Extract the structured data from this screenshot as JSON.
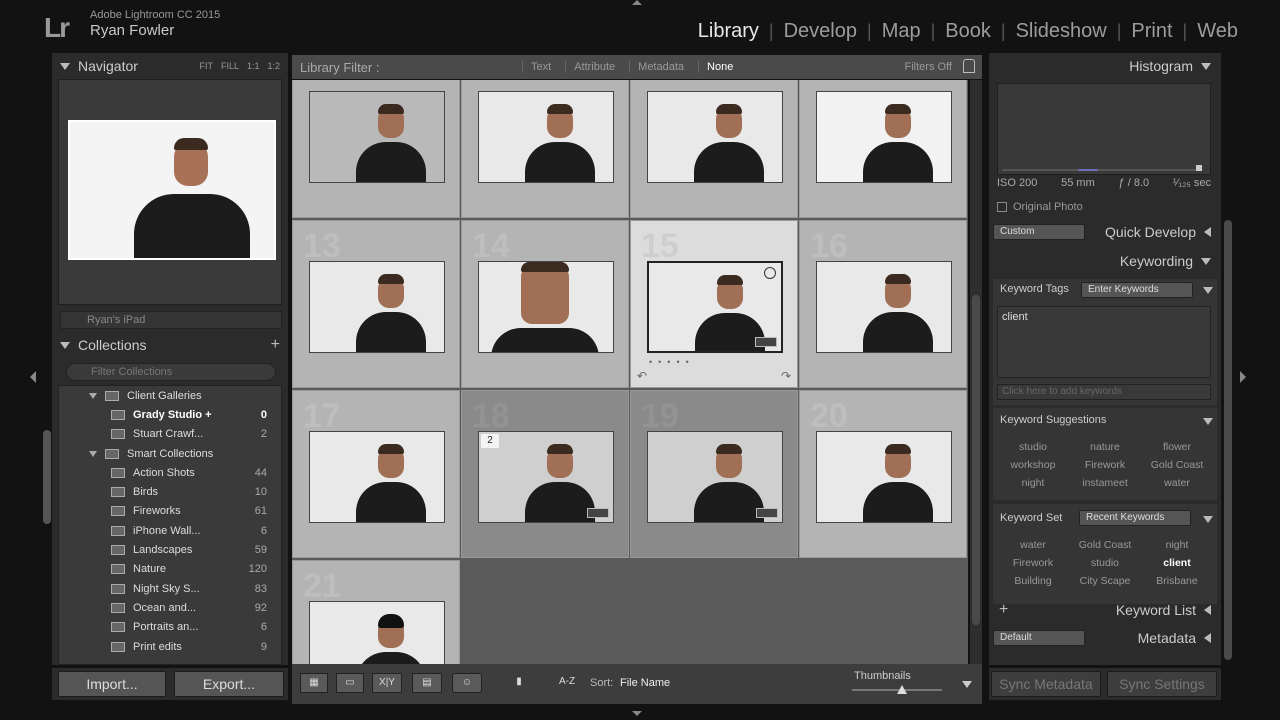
{
  "identity": {
    "logo": "Lr",
    "app_name": "Adobe Lightroom CC 2015",
    "user": "Ryan Fowler"
  },
  "modules": [
    "Library",
    "Develop",
    "Map",
    "Book",
    "Slideshow",
    "Print",
    "Web"
  ],
  "active_module": "Library",
  "navigator": {
    "title": "Navigator",
    "zoom_options": [
      "FIT",
      "FILL",
      "1:1",
      "1:2"
    ]
  },
  "device_item": "Ryan's iPad",
  "collections": {
    "title": "Collections",
    "filter_placeholder": "Filter Collections",
    "items": [
      {
        "name": "Client Galleries",
        "count": "",
        "type": "set"
      },
      {
        "name": "Grady Studio +",
        "count": "0",
        "type": "collection",
        "bold": true
      },
      {
        "name": "Stuart Crawf...",
        "count": "2",
        "type": "collection"
      },
      {
        "name": "Smart Collections",
        "count": "",
        "type": "set"
      },
      {
        "name": "Action Shots",
        "count": "44",
        "type": "smart"
      },
      {
        "name": "Birds",
        "count": "10",
        "type": "smart"
      },
      {
        "name": "Fireworks",
        "count": "61",
        "type": "smart"
      },
      {
        "name": "iPhone Wall...",
        "count": "6",
        "type": "smart"
      },
      {
        "name": "Landscapes",
        "count": "59",
        "type": "smart"
      },
      {
        "name": "Nature",
        "count": "120",
        "type": "smart"
      },
      {
        "name": "Night Sky S...",
        "count": "83",
        "type": "smart"
      },
      {
        "name": "Ocean and...",
        "count": "92",
        "type": "smart"
      },
      {
        "name": "Portraits an...",
        "count": "6",
        "type": "smart"
      },
      {
        "name": "Print edits",
        "count": "9",
        "type": "smart"
      }
    ]
  },
  "left_buttons": {
    "import": "Import...",
    "export": "Export..."
  },
  "library_filter": {
    "label": "Library Filter :",
    "options": [
      "Text",
      "Attribute",
      "Metadata",
      "None"
    ],
    "selected": "None",
    "filters_state": "Filters Off"
  },
  "grid": {
    "cells": [
      {
        "num": "",
        "stack": "",
        "selected": false,
        "dark": false
      },
      {
        "num": "",
        "stack": "",
        "selected": false,
        "dark": false
      },
      {
        "num": "",
        "stack": "",
        "selected": false,
        "dark": false
      },
      {
        "num": "",
        "stack": "",
        "selected": false,
        "dark": false
      },
      {
        "num": "13",
        "stack": "",
        "selected": false,
        "dark": false
      },
      {
        "num": "14",
        "stack": "",
        "selected": false,
        "dark": false
      },
      {
        "num": "15",
        "stack": "",
        "selected": true,
        "dark": false
      },
      {
        "num": "16",
        "stack": "",
        "selected": false,
        "dark": false
      },
      {
        "num": "17",
        "stack": "",
        "selected": false,
        "dark": false
      },
      {
        "num": "18",
        "stack": "2",
        "selected": false,
        "dark": true
      },
      {
        "num": "19",
        "stack": "",
        "selected": false,
        "dark": true
      },
      {
        "num": "20",
        "stack": "",
        "selected": false,
        "dark": false
      },
      {
        "num": "21",
        "stack": "",
        "selected": false,
        "dark": false
      }
    ]
  },
  "toolbar": {
    "sort_label": "Sort:",
    "sort_value": "File Name",
    "thumbnails_label": "Thumbnails",
    "thumbnail_size": 0.55,
    "survey_label": "X|Y",
    "sort_az": "A-Z"
  },
  "histogram": {
    "title": "Histogram",
    "iso": "ISO 200",
    "focal": "55 mm",
    "aperture": "ƒ / 8.0",
    "shutter": "¹⁄₁₂₅ sec",
    "original_photo": "Original Photo"
  },
  "quick_develop": {
    "title": "Quick Develop",
    "preset": "Custom"
  },
  "keywording": {
    "title": "Keywording",
    "tags_label": "Keyword Tags",
    "tags_mode": "Enter Keywords",
    "keywords": "client",
    "add_placeholder": "Click here to add keywords",
    "suggestions_title": "Keyword Suggestions",
    "suggestions": [
      "studio",
      "nature",
      "flower",
      "workshop",
      "Firework",
      "Gold Coast",
      "night",
      "instameet",
      "water"
    ],
    "set_label": "Keyword Set",
    "set_value": "Recent Keywords",
    "set_items": [
      "water",
      "Gold Coast",
      "night",
      "Firework",
      "studio",
      "client",
      "Building",
      "City Scape",
      "Brisbane"
    ],
    "set_bold": "client"
  },
  "keyword_list": {
    "title": "Keyword List"
  },
  "metadata": {
    "title": "Metadata",
    "preset": "Default"
  },
  "right_buttons": {
    "sync_metadata": "Sync Metadata",
    "sync_settings": "Sync Settings"
  }
}
